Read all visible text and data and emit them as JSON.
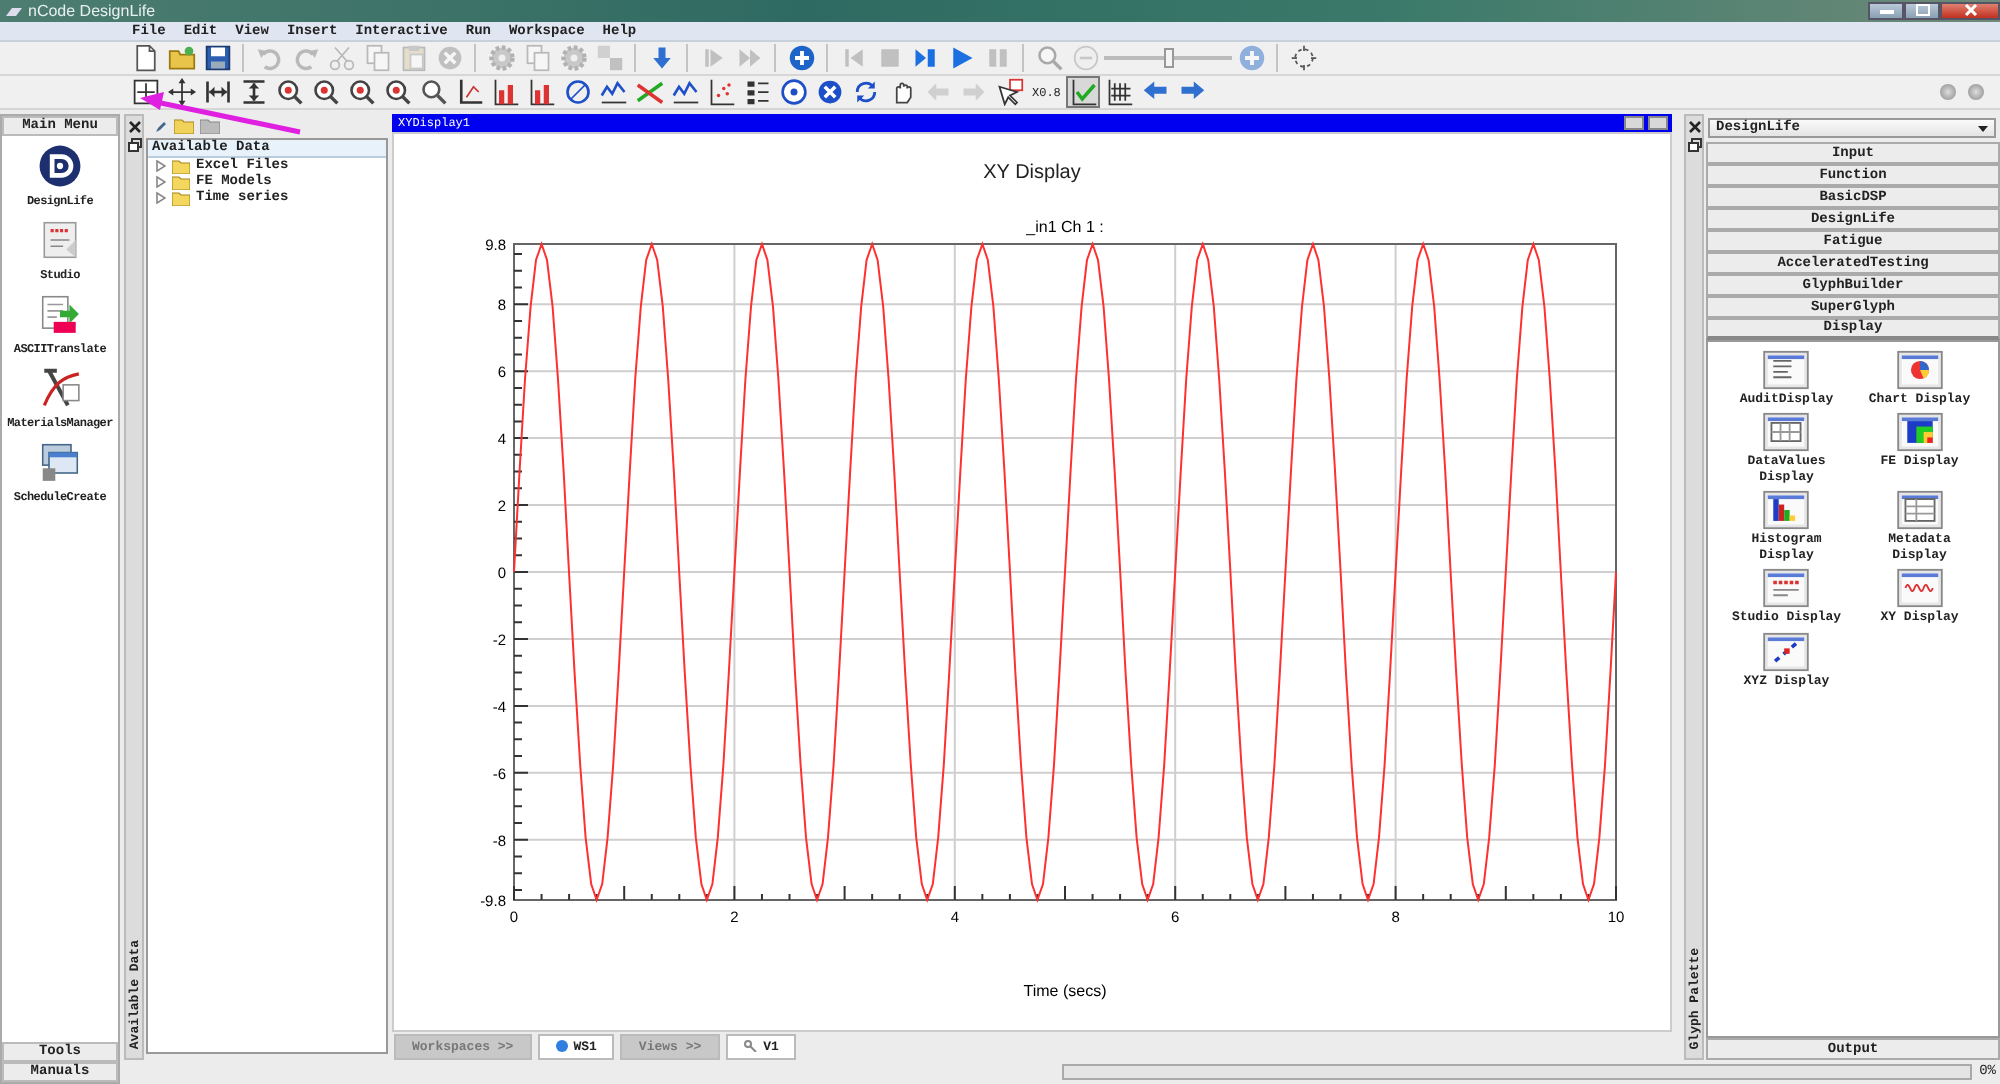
{
  "window": {
    "title": "nCode DesignLife"
  },
  "menu": [
    "File",
    "Edit",
    "View",
    "Insert",
    "Interactive",
    "Run",
    "Workspace",
    "Help"
  ],
  "toolbar_1": [
    {
      "kind": "page",
      "disabled": false
    },
    {
      "kind": "folder",
      "disabled": false
    },
    {
      "kind": "save",
      "disabled": false
    },
    {
      "kind": "separator"
    },
    {
      "kind": "undo",
      "disabled": true
    },
    {
      "kind": "redo",
      "disabled": true
    },
    {
      "kind": "scissors",
      "disabled": true
    },
    {
      "kind": "copy",
      "disabled": true
    },
    {
      "kind": "paste",
      "disabled": true
    },
    {
      "kind": "x-circle",
      "disabled": true
    },
    {
      "kind": "separator"
    },
    {
      "kind": "gear",
      "disabled": true
    },
    {
      "kind": "copy",
      "disabled": true
    },
    {
      "kind": "gear",
      "disabled": true
    },
    {
      "kind": "transfer",
      "disabled": true
    },
    {
      "kind": "separator"
    },
    {
      "kind": "down-arrow",
      "disabled": false
    },
    {
      "kind": "separator"
    },
    {
      "kind": "skip",
      "disabled": true
    },
    {
      "kind": "fast-forward",
      "disabled": true
    },
    {
      "kind": "separator"
    },
    {
      "kind": "plus-circle",
      "disabled": false
    },
    {
      "kind": "separator"
    },
    {
      "kind": "first",
      "disabled": true
    },
    {
      "kind": "stop",
      "disabled": true
    },
    {
      "kind": "next",
      "disabled": false
    },
    {
      "kind": "play",
      "disabled": false
    },
    {
      "kind": "pause",
      "disabled": true
    },
    {
      "kind": "separator"
    },
    {
      "kind": "magnifier",
      "disabled": true
    },
    {
      "kind": "minus-circle",
      "disabled": true
    },
    {
      "kind": "slider",
      "level": 0.5
    },
    {
      "kind": "plus-circle",
      "disabled": true
    },
    {
      "kind": "separator"
    },
    {
      "kind": "crosshair",
      "disabled": false
    }
  ],
  "toolbar_2": [
    {
      "kind": "frame",
      "disabled": false,
      "pressed": false
    },
    {
      "kind": "move",
      "disabled": false,
      "pressed": false
    },
    {
      "kind": "fit-x",
      "disabled": false,
      "pressed": false
    },
    {
      "kind": "fit-y",
      "disabled": false,
      "pressed": false
    },
    {
      "kind": "zoom",
      "disabled": false,
      "pressed": false
    },
    {
      "kind": "zoom",
      "disabled": false,
      "pressed": false
    },
    {
      "kind": "zoom",
      "disabled": false,
      "pressed": false
    },
    {
      "kind": "zoom",
      "disabled": false,
      "pressed": false
    },
    {
      "kind": "magnifier",
      "disabled": false,
      "pressed": false
    },
    {
      "kind": "axis",
      "disabled": false,
      "pressed": false
    },
    {
      "kind": "bar",
      "disabled": false,
      "pressed": false
    },
    {
      "kind": "bar",
      "disabled": false,
      "pressed": false
    },
    {
      "kind": "circle-axis",
      "disabled": false,
      "pressed": false
    },
    {
      "kind": "line",
      "disabled": false,
      "pressed": false
    },
    {
      "kind": "line-cross",
      "disabled": false,
      "pressed": false
    },
    {
      "kind": "line",
      "disabled": false,
      "pressed": false
    },
    {
      "kind": "scatter",
      "disabled": false,
      "pressed": false
    },
    {
      "kind": "legend",
      "disabled": false,
      "pressed": false
    },
    {
      "kind": "circle-dots",
      "disabled": false,
      "pressed": false
    },
    {
      "kind": "circle-x",
      "disabled": false,
      "pressed": false
    },
    {
      "kind": "refresh",
      "disabled": false,
      "pressed": false
    },
    {
      "kind": "hand",
      "disabled": false,
      "pressed": false
    },
    {
      "kind": "left",
      "disabled": true,
      "pressed": false
    },
    {
      "kind": "right",
      "disabled": true,
      "pressed": false
    },
    {
      "kind": "cursor",
      "disabled": false,
      "pressed": false
    },
    {
      "kind": "text",
      "label": "X0.8",
      "disabled": false,
      "pressed": false
    },
    {
      "kind": "check",
      "disabled": false,
      "pressed": true
    },
    {
      "kind": "table",
      "disabled": false,
      "pressed": false
    },
    {
      "kind": "back",
      "disabled": false,
      "pressed": false
    },
    {
      "kind": "forward",
      "disabled": false,
      "pressed": false
    }
  ],
  "main_menu": {
    "title": "Main Menu",
    "items": [
      {
        "label": "DesignLife"
      },
      {
        "label": "Studio"
      },
      {
        "label": "ASCIITranslate"
      },
      {
        "label": "MaterialsManager"
      },
      {
        "label": "ScheduleCreate"
      }
    ],
    "footer": [
      "Tools",
      "Manuals"
    ]
  },
  "data_panel": {
    "side_label": "Available Data",
    "header": "Available Data",
    "tree": [
      {
        "label": "Excel Files",
        "expanded": false
      },
      {
        "label": "FE Models",
        "expanded": false
      },
      {
        "label": "Time series",
        "expanded": false
      }
    ]
  },
  "display": {
    "window_title": "XYDisplay1",
    "heading": "XY Display",
    "chart_data": {
      "type": "line",
      "title": "_in1  Ch 1 :",
      "xlabel": "Time (secs)",
      "xlim": [
        0,
        10
      ],
      "ylim": [
        -9.8,
        9.8
      ],
      "xticks": [
        0,
        2,
        4,
        6,
        8,
        10
      ],
      "yticks": [
        -9.8,
        -8,
        -6,
        -4,
        -2,
        0,
        2,
        4,
        6,
        8,
        9.8
      ],
      "x": [
        0,
        0.05,
        0.1,
        0.15,
        0.2,
        0.25,
        0.3,
        0.35,
        0.4,
        0.45,
        0.5,
        0.55,
        0.6,
        0.65,
        0.7,
        0.75,
        0.8,
        0.85,
        0.9,
        0.95,
        1,
        1.05,
        1.1,
        1.15,
        1.2,
        1.25,
        1.3,
        1.35,
        1.4,
        1.45,
        1.5,
        1.55,
        1.6,
        1.65,
        1.7,
        1.75,
        1.8,
        1.85,
        1.9,
        1.95,
        2,
        2.05,
        2.1,
        2.15,
        2.2,
        2.25,
        2.3,
        2.35,
        2.4,
        2.45,
        2.5,
        2.55,
        2.6,
        2.65,
        2.7,
        2.75,
        2.8,
        2.85,
        2.9,
        2.95,
        3,
        3.05,
        3.1,
        3.15,
        3.2,
        3.25,
        3.3,
        3.35,
        3.4,
        3.45,
        3.5,
        3.55,
        3.6,
        3.65,
        3.7,
        3.75,
        3.8,
        3.85,
        3.9,
        3.95,
        4,
        4.05,
        4.1,
        4.15,
        4.2,
        4.25,
        4.3,
        4.35,
        4.4,
        4.45,
        4.5,
        4.55,
        4.6,
        4.65,
        4.7,
        4.75,
        4.8,
        4.85,
        4.9,
        4.95,
        5,
        5.05,
        5.1,
        5.15,
        5.2,
        5.25,
        5.3,
        5.35,
        5.4,
        5.45,
        5.5,
        5.55,
        5.6,
        5.65,
        5.7,
        5.75,
        5.8,
        5.85,
        5.9,
        5.95,
        6,
        6.05,
        6.1,
        6.15,
        6.2,
        6.25,
        6.3,
        6.35,
        6.4,
        6.45,
        6.5,
        6.55,
        6.6,
        6.65,
        6.7,
        6.75,
        6.8,
        6.85,
        6.9,
        6.95,
        7,
        7.05,
        7.1,
        7.15,
        7.2,
        7.25,
        7.3,
        7.35,
        7.4,
        7.45,
        7.5,
        7.55,
        7.6,
        7.65,
        7.7,
        7.75,
        7.8,
        7.85,
        7.9,
        7.95,
        8,
        8.05,
        8.1,
        8.15,
        8.2,
        8.25,
        8.3,
        8.35,
        8.4,
        8.45,
        8.5,
        8.55,
        8.6,
        8.65,
        8.7,
        8.75,
        8.8,
        8.85,
        8.9,
        8.95,
        9,
        9.05,
        9.1,
        9.15,
        9.2,
        9.25,
        9.3,
        9.35,
        9.4,
        9.45,
        9.5,
        9.55,
        9.6,
        9.65,
        9.7,
        9.75,
        9.8,
        9.85,
        9.9,
        9.95,
        10
      ],
      "grid": true,
      "series": [
        {
          "color": "#ff3030",
          "values": [
            0,
            3.03,
            5.76,
            7.93,
            9.32,
            9.8,
            9.32,
            7.93,
            5.76,
            3.03,
            0,
            -3.03,
            -5.76,
            -7.93,
            -9.32,
            -9.8,
            -9.32,
            -7.93,
            -5.76,
            -3.03,
            0,
            3.03,
            5.76,
            7.93,
            9.32,
            9.8,
            9.32,
            7.93,
            5.76,
            3.03,
            0,
            -3.03,
            -5.76,
            -7.93,
            -9.32,
            -9.8,
            -9.32,
            -7.93,
            -5.76,
            -3.03,
            0,
            3.03,
            5.76,
            7.93,
            9.32,
            9.8,
            9.32,
            7.93,
            5.76,
            3.03,
            0,
            -3.03,
            -5.76,
            -7.93,
            -9.32,
            -9.8,
            -9.32,
            -7.93,
            -5.76,
            -3.03,
            0,
            3.03,
            5.76,
            7.93,
            9.32,
            9.8,
            9.32,
            7.93,
            5.76,
            3.03,
            0,
            -3.03,
            -5.76,
            -7.93,
            -9.32,
            -9.8,
            -9.32,
            -7.93,
            -5.76,
            -3.03,
            0,
            3.03,
            5.76,
            7.93,
            9.32,
            9.8,
            9.32,
            7.93,
            5.76,
            3.03,
            0,
            -3.03,
            -5.76,
            -7.93,
            -9.32,
            -9.8,
            -9.32,
            -7.93,
            -5.76,
            -3.03,
            0,
            3.03,
            5.76,
            7.93,
            9.32,
            9.8,
            9.32,
            7.93,
            5.76,
            3.03,
            0,
            -3.03,
            -5.76,
            -7.93,
            -9.32,
            -9.8,
            -9.32,
            -7.93,
            -5.76,
            -3.03,
            0,
            3.03,
            5.76,
            7.93,
            9.32,
            9.8,
            9.32,
            7.93,
            5.76,
            3.03,
            0,
            -3.03,
            -5.76,
            -7.93,
            -9.32,
            -9.8,
            -9.32,
            -7.93,
            -5.76,
            -3.03,
            0,
            3.03,
            5.76,
            7.93,
            9.32,
            9.8,
            9.32,
            7.93,
            5.76,
            3.03,
            0,
            -3.03,
            -5.76,
            -7.93,
            -9.32,
            -9.8,
            -9.32,
            -7.93,
            -5.76,
            -3.03,
            0,
            3.03,
            5.76,
            7.93,
            9.32,
            9.8,
            9.32,
            7.93,
            5.76,
            3.03,
            0,
            -3.03,
            -5.76,
            -7.93,
            -9.32,
            -9.8,
            -9.32,
            -7.93,
            -5.76,
            -3.03,
            0,
            3.03,
            5.76,
            7.93,
            9.32,
            9.8,
            9.32,
            7.93,
            5.76,
            3.03,
            0,
            -3.03,
            -5.76,
            -7.93,
            -9.32,
            -9.8,
            -9.32,
            -7.93,
            -5.76,
            -3.03,
            0
          ]
        }
      ]
    }
  },
  "bottom_tabs": [
    {
      "label": "Workspaces >>",
      "kind": "header"
    },
    {
      "label": "WS1",
      "kind": "tab"
    },
    {
      "label": "Views >>",
      "kind": "header"
    },
    {
      "label": "V1",
      "kind": "tab"
    }
  ],
  "palette": {
    "side_label": "Glyph Palette",
    "dropdown": "DesignLife",
    "categories": [
      {
        "label": "Input",
        "expanded": false
      },
      {
        "label": "Function",
        "expanded": false
      },
      {
        "label": "BasicDSP",
        "expanded": false
      },
      {
        "label": "DesignLife",
        "expanded": false
      },
      {
        "label": "Fatigue",
        "expanded": false
      },
      {
        "label": "AcceleratedTesting",
        "expanded": false
      },
      {
        "label": "GlyphBuilder",
        "expanded": false
      },
      {
        "label": "SuperGlyph",
        "expanded": false
      },
      {
        "label": "Display",
        "expanded": true
      }
    ],
    "glyphs": [
      {
        "label": "AuditDisplay"
      },
      {
        "label": "Chart Display"
      },
      {
        "label": "DataValues Display"
      },
      {
        "label": "FE Display"
      },
      {
        "label": "Histogram Display"
      },
      {
        "label": "Metadata Display"
      },
      {
        "label": "Studio Display"
      },
      {
        "label": "XY Display"
      },
      {
        "label": "XYZ Display"
      }
    ],
    "output": "Output"
  },
  "status": {
    "progress": {
      "level": 0,
      "reading": "0%"
    }
  }
}
